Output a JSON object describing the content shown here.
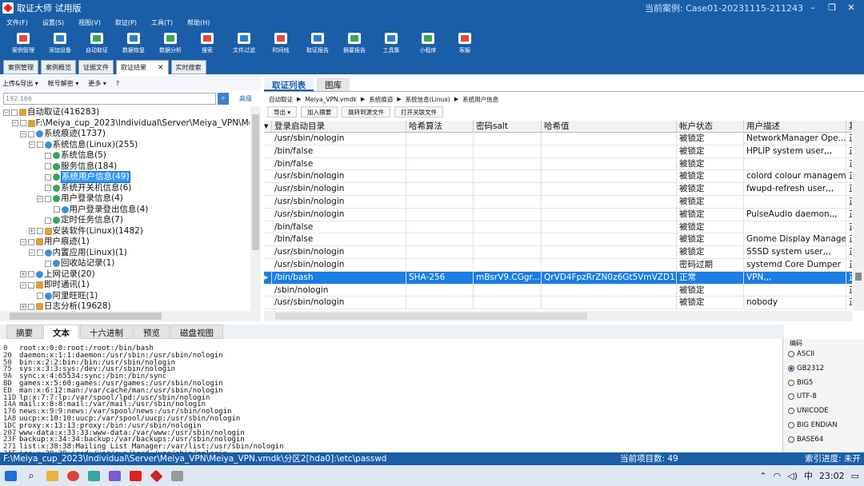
{
  "app": {
    "title": "取证大师 试用版",
    "case": "当前案例: Case01-20231115-211243"
  },
  "menu": [
    "文件(F)",
    "设置(S)",
    "视图(V)",
    "取证(P)",
    "工具(T)",
    "帮助(H)"
  ],
  "toolbar": [
    "案例管理",
    "添加设备",
    "自动取证",
    "数据恢复",
    "数据分析",
    "搜索",
    "文件过滤",
    "时间线",
    "取证报告",
    "摘要报告",
    "工具集",
    "小程序",
    "客服"
  ],
  "tabs": [
    "案例管理",
    "案例概览",
    "证据文件",
    "取证结果",
    "实时搜索"
  ],
  "left": {
    "tools": [
      "上传&导出 ▾",
      "帐号解密 ▾",
      "更多 ▾",
      "?"
    ],
    "search": "192.166",
    "advanced": "高级",
    "tree": [
      {
        "label": "自动取证(416283)",
        "indent": 0,
        "tgl": "−",
        "icon": "f"
      },
      {
        "label": "F:\\Meiya_cup_2023\\Individual\\Server\\Meiya_VPN\\Meiy",
        "indent": 1,
        "tgl": "−",
        "icon": "f"
      },
      {
        "label": "系统痕迹(1737)",
        "indent": 2,
        "tgl": "−",
        "icon": "b"
      },
      {
        "label": "系统信息(Linux)(255)",
        "indent": 3,
        "tgl": "−",
        "icon": "b"
      },
      {
        "label": "系统信息(5)",
        "indent": 4,
        "tgl": "",
        "icon": "g"
      },
      {
        "label": "服务信息(184)",
        "indent": 4,
        "tgl": "",
        "icon": "g"
      },
      {
        "label": "系统用户信息(49)",
        "indent": 4,
        "tgl": "",
        "icon": "g",
        "sel": true
      },
      {
        "label": "系统开关机信息(6)",
        "indent": 4,
        "tgl": "",
        "icon": "g"
      },
      {
        "label": "用户登录信息(4)",
        "indent": 4,
        "tgl": "−",
        "icon": "g"
      },
      {
        "label": "用户登录登出信息(4)",
        "indent": 5,
        "tgl": "",
        "icon": "b"
      },
      {
        "label": "定时任务信息(7)",
        "indent": 4,
        "tgl": "",
        "icon": "g"
      },
      {
        "label": "安装软件(Linux)(1482)",
        "indent": 3,
        "tgl": "+",
        "icon": "f"
      },
      {
        "label": "用户痕迹(1)",
        "indent": 2,
        "tgl": "−",
        "icon": "f"
      },
      {
        "label": "内置应用(Linux)(1)",
        "indent": 3,
        "tgl": "−",
        "icon": "b"
      },
      {
        "label": "回收站记录(1)",
        "indent": 4,
        "tgl": "",
        "icon": "b"
      },
      {
        "label": "上网记录(20)",
        "indent": 2,
        "tgl": "+",
        "icon": "b"
      },
      {
        "label": "即时通讯(1)",
        "indent": 2,
        "tgl": "−",
        "icon": "f"
      },
      {
        "label": "阿里旺旺(1)",
        "indent": 3,
        "tgl": "",
        "icon": "b"
      },
      {
        "label": "日志分析(19628)",
        "indent": 2,
        "tgl": "+",
        "icon": "f"
      }
    ]
  },
  "right": {
    "tabs": [
      "取证列表",
      "图库"
    ],
    "crumb": [
      "自动取证",
      "Meiya_VPN.vmdk",
      "系统痕迹",
      "系统信息(Linux)",
      "系统用户信息"
    ],
    "tools": [
      "导出 ▾",
      "加入摘要",
      "跳转到源文件",
      "打开关联文件"
    ],
    "columns": [
      "登录启动目录",
      "哈希算法",
      "密码salt",
      "哈希值",
      "帐户状态",
      "用户描述",
      "其"
    ],
    "rows": [
      [
        "/usr/sbin/nologin",
        "",
        "",
        "",
        "被锁定",
        "NetworkManager Ope...",
        "正"
      ],
      [
        "/bin/false",
        "",
        "",
        "",
        "被锁定",
        "HPLIP system user,,,",
        "正"
      ],
      [
        "/bin/false",
        "",
        "",
        "",
        "被锁定",
        "",
        "正"
      ],
      [
        "/usr/sbin/nologin",
        "",
        "",
        "",
        "被锁定",
        "colord colour managem...",
        "正"
      ],
      [
        "/usr/sbin/nologin",
        "",
        "",
        "",
        "被锁定",
        "fwupd-refresh user,,,",
        "正"
      ],
      [
        "/usr/sbin/nologin",
        "",
        "",
        "",
        "被锁定",
        "",
        "正"
      ],
      [
        "/usr/sbin/nologin",
        "",
        "",
        "",
        "被锁定",
        "PulseAudio daemon,,,",
        "正"
      ],
      [
        "/bin/false",
        "",
        "",
        "",
        "被锁定",
        "",
        "正"
      ],
      [
        "/bin/false",
        "",
        "",
        "",
        "被锁定",
        "Gnome Display Manager",
        "正"
      ],
      [
        "/usr/sbin/nologin",
        "",
        "",
        "",
        "被锁定",
        "SSSD system user,,,",
        "正"
      ],
      [
        "/usr/sbin/nologin",
        "",
        "",
        "",
        "密码过期",
        "systemd Core Dumper",
        "正"
      ],
      [
        "/bin/bash",
        "SHA-256",
        "mBsrV9.CGgr...",
        "QrVD4FpzRrZN0z6Gt5VmVZD1...",
        "正常",
        "VPN,,,",
        "正"
      ],
      [
        "/sbin/nologin",
        "",
        "",
        "",
        "被锁定",
        "",
        "正"
      ],
      [
        "/usr/sbin/nologin",
        "",
        "",
        "",
        "被锁定",
        "nobody",
        "正"
      ]
    ],
    "selected": 11
  },
  "bottom": {
    "tabs": [
      "摘要",
      "文本",
      "十六进制",
      "预览",
      "磁盘视图"
    ],
    "lines": [
      [
        "0",
        "root:x:0:0:root:/root:/bin/bash"
      ],
      [
        "20",
        "daemon:x:1:1:daemon:/usr/sbin:/usr/sbin/nologin"
      ],
      [
        "50",
        "bin:x:2:2:bin:/bin:/usr/sbin/nologin"
      ],
      [
        "75",
        "sys:x:3:3:sys:/dev:/usr/sbin/nologin"
      ],
      [
        "9A",
        "sync:x:4:65534:sync:/bin:/bin/sync"
      ],
      [
        "BD",
        "games:x:5:60:games:/usr/games:/usr/sbin/nologin"
      ],
      [
        "ED",
        "man:x:6:12:man:/var/cache/man:/usr/sbin/nologin"
      ],
      [
        "11D",
        "lp:x:7:7:lp:/var/spool/lpd:/usr/sbin/nologin"
      ],
      [
        "14A",
        "mail:x:8:8:mail:/var/mail:/usr/sbin/nologin"
      ],
      [
        "176",
        "news:x:9:9:news:/var/spool/news:/usr/sbin/nologin"
      ],
      [
        "1A8",
        "uucp:x:10:10:uucp:/var/spool/uucp:/usr/sbin/nologin"
      ],
      [
        "1DC",
        "proxy:x:13:13:proxy:/bin:/usr/sbin/nologin"
      ],
      [
        "207",
        "www-data:x:33:33:www-data:/var/www:/usr/sbin/nologin"
      ],
      [
        "23F",
        "backup:x:34:34:backup:/var/backups:/usr/sbin/nologin"
      ],
      [
        "271",
        "list:x:38:38:Mailing List Manager:/var/list:/usr/sbin/nologin"
      ],
      [
        "2AF",
        "irc:x:39:39:ircd:/var/run/ircd:/usr/sbin/nologin"
      ]
    ],
    "encoding": {
      "title": "编码",
      "options": [
        "ASCII",
        "GB2312",
        "BIG5",
        "UTF-8",
        "UNICODE",
        "BIG ENDIAN",
        "BASE64"
      ],
      "selected": 1
    }
  },
  "status": {
    "path": "F:\\Meiya_cup_2023\\Individual\\Server\\Meiya_VPN\\Meiya_VPN.vmdk\\分区2[hda0]:\\etc\\passwd",
    "count": "当前项目数: 49",
    "index": "索引进度: 未开始"
  },
  "taskbar": {
    "time": "23:02",
    "lang": "中"
  }
}
